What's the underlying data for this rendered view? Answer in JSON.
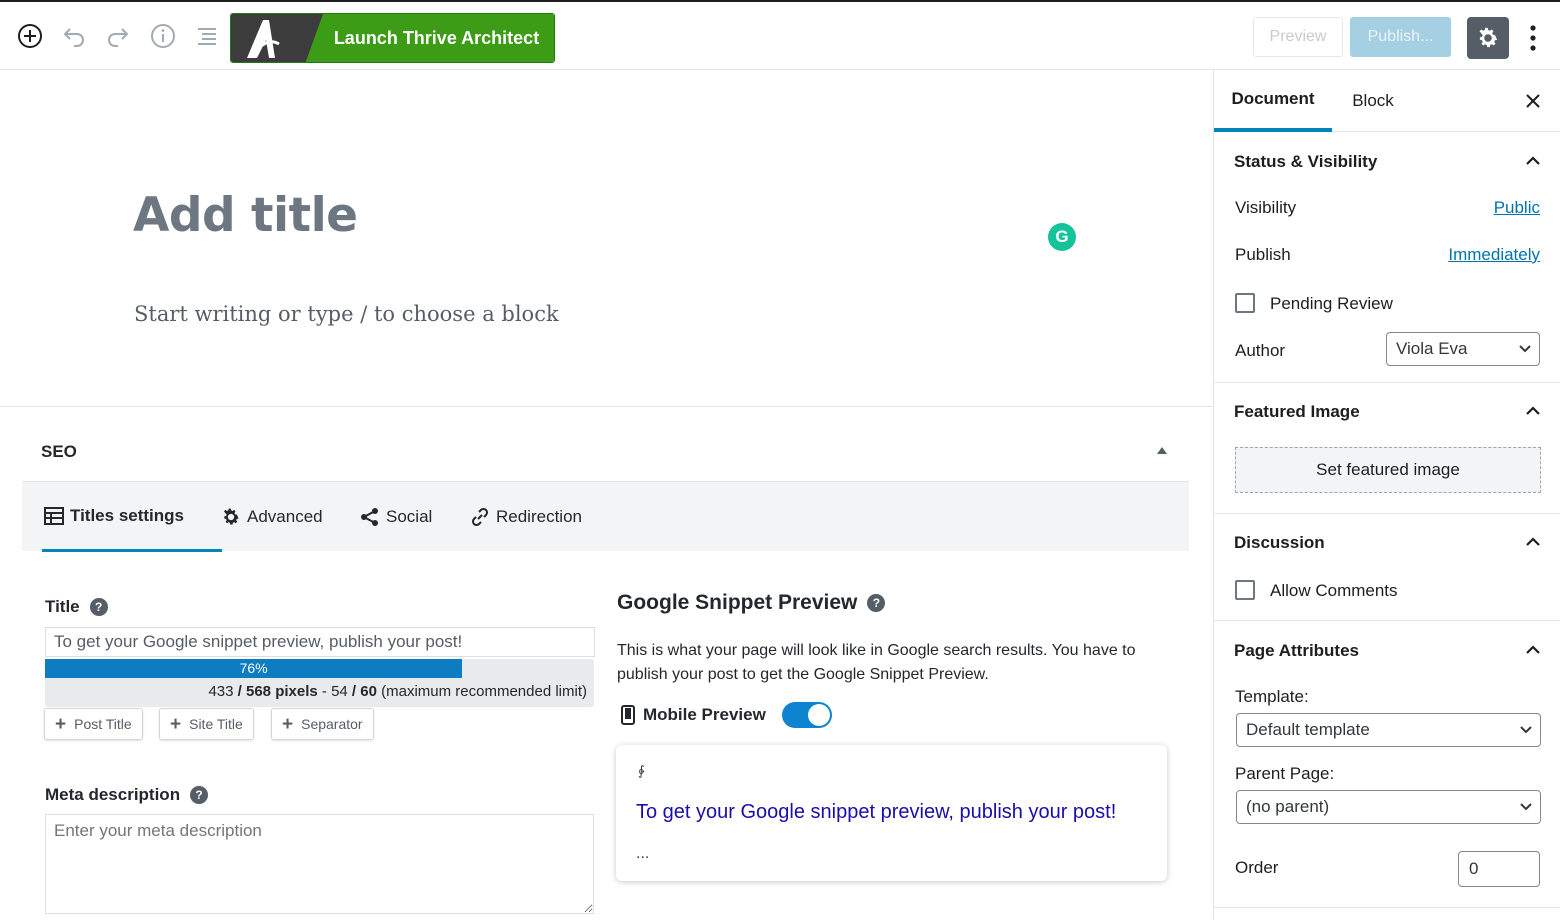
{
  "toolbar": {
    "thrive_label": "Launch Thrive Architect",
    "preview_label": "Preview",
    "publish_label": "Publish...",
    "icons": [
      "add-block-icon",
      "undo-icon",
      "redo-icon",
      "info-icon",
      "outline-icon",
      "gear-icon",
      "more-icon"
    ]
  },
  "editor": {
    "title_placeholder": "Add title",
    "block_placeholder": "Start writing or type / to choose a block",
    "grammarly_letter": "G"
  },
  "seo": {
    "heading": "SEO",
    "tabs": [
      {
        "label": "Titles settings",
        "icon": "table-icon",
        "active": true
      },
      {
        "label": "Advanced",
        "icon": "gear-icon",
        "active": false
      },
      {
        "label": "Social",
        "icon": "share-icon",
        "active": false
      },
      {
        "label": "Redirection",
        "icon": "link-icon",
        "active": false
      }
    ],
    "title_label": "Title",
    "title_value": "To get your Google snippet preview, publish your post!",
    "progress": {
      "percent_label": "76%",
      "percent": 76,
      "pixels_used": "433",
      "pixels_sep": " / ",
      "pixels_max": "568 pixels",
      "chars_sep": " - ",
      "chars_used": "54",
      "chars_slash": " / ",
      "chars_max": "60",
      "limit_note": " (maximum recommended limit)"
    },
    "variable_buttons": [
      "Post Title",
      "Site Title",
      "Separator"
    ],
    "meta_label": "Meta description",
    "meta_placeholder": "Enter your meta description",
    "snippet": {
      "heading": "Google Snippet Preview",
      "description": "This is what your page will look like in Google search results. You have to publish your post to get the Google Snippet Preview.",
      "mobile_label": "Mobile Preview",
      "mobile_on": true,
      "url_glyph": "∳",
      "link_text": "To get your Google snippet preview, publish your post!",
      "ellipsis": "..."
    }
  },
  "sidebar": {
    "tabs": [
      "Document",
      "Block"
    ],
    "status": {
      "title": "Status & Visibility",
      "visibility_label": "Visibility",
      "visibility_value": "Public",
      "publish_label": "Publish",
      "publish_value": "Immediately",
      "pending_label": "Pending Review",
      "author_label": "Author",
      "author_value": "Viola Eva"
    },
    "featured": {
      "title": "Featured Image",
      "button": "Set featured image"
    },
    "discussion": {
      "title": "Discussion",
      "allow_label": "Allow Comments"
    },
    "attributes": {
      "title": "Page Attributes",
      "template_label": "Template:",
      "template_value": "Default template",
      "parent_label": "Parent Page:",
      "parent_value": "(no parent)",
      "order_label": "Order",
      "order_value": "0"
    }
  },
  "colors": {
    "accent": "#0085ba",
    "thrive_green": "#3d9c16",
    "link": "#0073aa",
    "google_link": "#1a0dab"
  }
}
